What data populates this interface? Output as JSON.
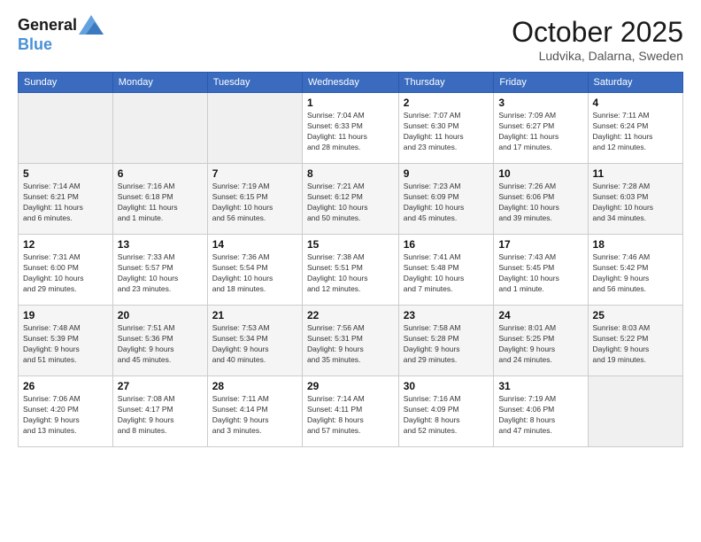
{
  "logo": {
    "line1": "General",
    "line2": "Blue"
  },
  "title": "October 2025",
  "subtitle": "Ludvika, Dalarna, Sweden",
  "weekdays": [
    "Sunday",
    "Monday",
    "Tuesday",
    "Wednesday",
    "Thursday",
    "Friday",
    "Saturday"
  ],
  "weeks": [
    [
      {
        "day": "",
        "info": ""
      },
      {
        "day": "",
        "info": ""
      },
      {
        "day": "",
        "info": ""
      },
      {
        "day": "1",
        "info": "Sunrise: 7:04 AM\nSunset: 6:33 PM\nDaylight: 11 hours\nand 28 minutes."
      },
      {
        "day": "2",
        "info": "Sunrise: 7:07 AM\nSunset: 6:30 PM\nDaylight: 11 hours\nand 23 minutes."
      },
      {
        "day": "3",
        "info": "Sunrise: 7:09 AM\nSunset: 6:27 PM\nDaylight: 11 hours\nand 17 minutes."
      },
      {
        "day": "4",
        "info": "Sunrise: 7:11 AM\nSunset: 6:24 PM\nDaylight: 11 hours\nand 12 minutes."
      }
    ],
    [
      {
        "day": "5",
        "info": "Sunrise: 7:14 AM\nSunset: 6:21 PM\nDaylight: 11 hours\nand 6 minutes."
      },
      {
        "day": "6",
        "info": "Sunrise: 7:16 AM\nSunset: 6:18 PM\nDaylight: 11 hours\nand 1 minute."
      },
      {
        "day": "7",
        "info": "Sunrise: 7:19 AM\nSunset: 6:15 PM\nDaylight: 10 hours\nand 56 minutes."
      },
      {
        "day": "8",
        "info": "Sunrise: 7:21 AM\nSunset: 6:12 PM\nDaylight: 10 hours\nand 50 minutes."
      },
      {
        "day": "9",
        "info": "Sunrise: 7:23 AM\nSunset: 6:09 PM\nDaylight: 10 hours\nand 45 minutes."
      },
      {
        "day": "10",
        "info": "Sunrise: 7:26 AM\nSunset: 6:06 PM\nDaylight: 10 hours\nand 39 minutes."
      },
      {
        "day": "11",
        "info": "Sunrise: 7:28 AM\nSunset: 6:03 PM\nDaylight: 10 hours\nand 34 minutes."
      }
    ],
    [
      {
        "day": "12",
        "info": "Sunrise: 7:31 AM\nSunset: 6:00 PM\nDaylight: 10 hours\nand 29 minutes."
      },
      {
        "day": "13",
        "info": "Sunrise: 7:33 AM\nSunset: 5:57 PM\nDaylight: 10 hours\nand 23 minutes."
      },
      {
        "day": "14",
        "info": "Sunrise: 7:36 AM\nSunset: 5:54 PM\nDaylight: 10 hours\nand 18 minutes."
      },
      {
        "day": "15",
        "info": "Sunrise: 7:38 AM\nSunset: 5:51 PM\nDaylight: 10 hours\nand 12 minutes."
      },
      {
        "day": "16",
        "info": "Sunrise: 7:41 AM\nSunset: 5:48 PM\nDaylight: 10 hours\nand 7 minutes."
      },
      {
        "day": "17",
        "info": "Sunrise: 7:43 AM\nSunset: 5:45 PM\nDaylight: 10 hours\nand 1 minute."
      },
      {
        "day": "18",
        "info": "Sunrise: 7:46 AM\nSunset: 5:42 PM\nDaylight: 9 hours\nand 56 minutes."
      }
    ],
    [
      {
        "day": "19",
        "info": "Sunrise: 7:48 AM\nSunset: 5:39 PM\nDaylight: 9 hours\nand 51 minutes."
      },
      {
        "day": "20",
        "info": "Sunrise: 7:51 AM\nSunset: 5:36 PM\nDaylight: 9 hours\nand 45 minutes."
      },
      {
        "day": "21",
        "info": "Sunrise: 7:53 AM\nSunset: 5:34 PM\nDaylight: 9 hours\nand 40 minutes."
      },
      {
        "day": "22",
        "info": "Sunrise: 7:56 AM\nSunset: 5:31 PM\nDaylight: 9 hours\nand 35 minutes."
      },
      {
        "day": "23",
        "info": "Sunrise: 7:58 AM\nSunset: 5:28 PM\nDaylight: 9 hours\nand 29 minutes."
      },
      {
        "day": "24",
        "info": "Sunrise: 8:01 AM\nSunset: 5:25 PM\nDaylight: 9 hours\nand 24 minutes."
      },
      {
        "day": "25",
        "info": "Sunrise: 8:03 AM\nSunset: 5:22 PM\nDaylight: 9 hours\nand 19 minutes."
      }
    ],
    [
      {
        "day": "26",
        "info": "Sunrise: 7:06 AM\nSunset: 4:20 PM\nDaylight: 9 hours\nand 13 minutes."
      },
      {
        "day": "27",
        "info": "Sunrise: 7:08 AM\nSunset: 4:17 PM\nDaylight: 9 hours\nand 8 minutes."
      },
      {
        "day": "28",
        "info": "Sunrise: 7:11 AM\nSunset: 4:14 PM\nDaylight: 9 hours\nand 3 minutes."
      },
      {
        "day": "29",
        "info": "Sunrise: 7:14 AM\nSunset: 4:11 PM\nDaylight: 8 hours\nand 57 minutes."
      },
      {
        "day": "30",
        "info": "Sunrise: 7:16 AM\nSunset: 4:09 PM\nDaylight: 8 hours\nand 52 minutes."
      },
      {
        "day": "31",
        "info": "Sunrise: 7:19 AM\nSunset: 4:06 PM\nDaylight: 8 hours\nand 47 minutes."
      },
      {
        "day": "",
        "info": ""
      }
    ]
  ]
}
